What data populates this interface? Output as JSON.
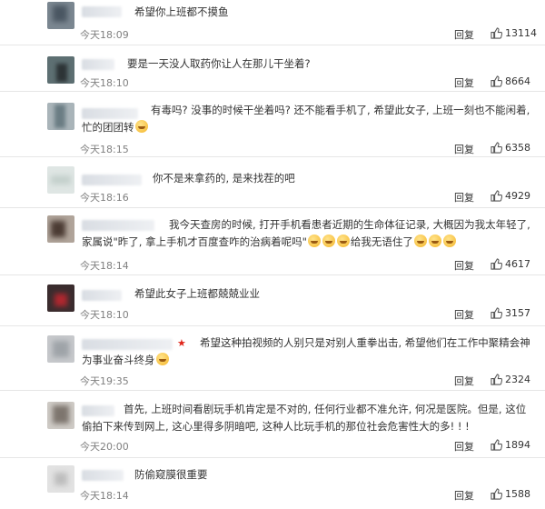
{
  "comments": [
    {
      "text": "希望你上班都不摸鱼",
      "time": "今天18:09",
      "reply": "回复",
      "likes": "13114",
      "emoji_after": false
    },
    {
      "text": "要是一天没人取药你让人在那儿干坐着?",
      "time": "今天18:10",
      "reply": "回复",
      "likes": "8664",
      "emoji_after": false
    },
    {
      "text": "有毒吗? 没事的时候干坐着吗? 还不能看手机了, 希望此女子, 上班一刻也不能闲着, 忙的团团转",
      "time": "今天18:15",
      "reply": "回复",
      "likes": "6358",
      "emoji_after": true
    },
    {
      "text": "你不是来拿药的, 是来找茬的吧",
      "time": "今天18:16",
      "reply": "回复",
      "likes": "4929",
      "emoji_after": false
    },
    {
      "text": "我今天查房的时候, 打开手机看患者近期的生命体征记录, 大概因为我太年轻了, 家属说\"昨了, 拿上手机才百度查咋的治病着呢吗\"",
      "text2": "给我无语住了",
      "time": "今天18:14",
      "reply": "回复",
      "likes": "4617",
      "emoji_after": false
    },
    {
      "text": "希望此女子上班都兢兢业业",
      "time": "今天18:10",
      "reply": "回复",
      "likes": "3157",
      "emoji_after": false
    },
    {
      "text": "希望这种拍视频的人别只是对别人重拳出击, 希望他们在工作中聚精会神为事业奋斗终身",
      "time": "今天19:35",
      "reply": "回复",
      "likes": "2324",
      "emoji_after": true
    },
    {
      "text": "首先, 上班时间看剧玩手机肯定是不对的, 任何行业都不准允许, 何况是医院。但是, 这位偷拍下来传到网上, 这心里得多阴暗吧, 这种人比玩手机的那位社会危害性大的多! ! !",
      "time": "今天20:00",
      "reply": "回复",
      "likes": "1894",
      "emoji_after": false
    },
    {
      "text": "防偷窥膜很重要",
      "time": "今天18:14",
      "reply": "回复",
      "likes": "1588",
      "emoji_after": false
    }
  ],
  "icons": {
    "like": "thumbs-up-icon",
    "vip": "star-icon"
  },
  "colors": {
    "time": "#808080",
    "star": "#e0261b",
    "divider": "#e6e6e6"
  }
}
